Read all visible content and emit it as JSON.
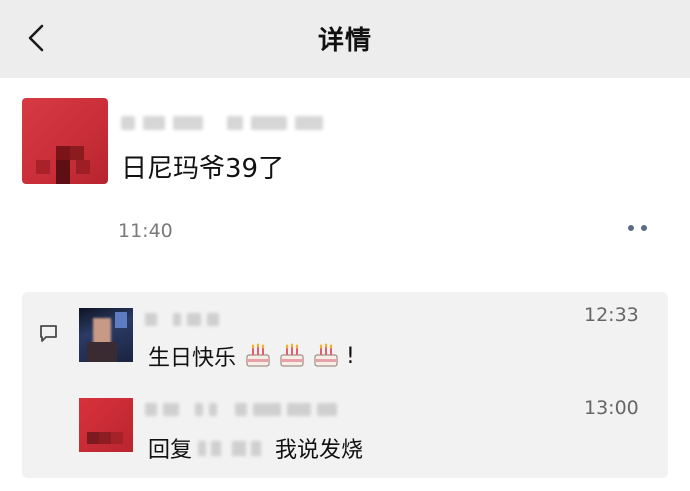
{
  "header": {
    "title": "详情",
    "back_icon": "chevron-left-icon"
  },
  "post": {
    "text": "日尼玛爷39了",
    "time": "11:40",
    "more_icon": "more-dots-icon"
  },
  "comments": [
    {
      "text_prefix": "生日快乐",
      "emoji": "birthday-cake-icon",
      "emoji_count": 3,
      "text_suffix": "!",
      "time": "12:33"
    },
    {
      "reply_label": "回复",
      "text": "我说发烧",
      "time": "13:00"
    }
  ],
  "colors": {
    "header_bg": "#ededed",
    "comments_bg": "#f2f2f2",
    "avatar_red": "#d63a44",
    "more_dots": "#5b6b8a"
  }
}
